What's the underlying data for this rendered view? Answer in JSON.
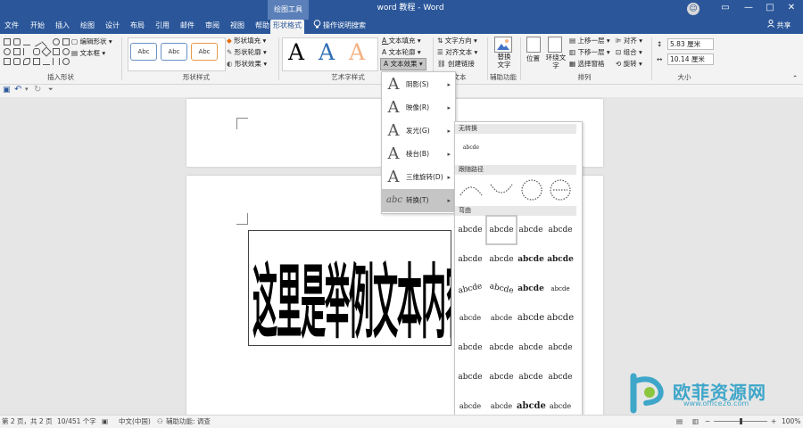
{
  "title_bar": {
    "context_tab": "绘图工具",
    "app_title": "word 教程 - Word",
    "avatar": "☺",
    "restore": "▭",
    "minimize": "—",
    "maximize": "□",
    "close": "✕"
  },
  "tabs": [
    "文件",
    "开始",
    "插入",
    "绘图",
    "设计",
    "布局",
    "引用",
    "邮件",
    "审阅",
    "视图",
    "帮助",
    "形状格式"
  ],
  "tell_me": "操作说明搜索",
  "share": "共享",
  "ribbon": {
    "insert_shape": {
      "edit_shape": "编辑形状",
      "text_box": "文本框",
      "label": "插入形状"
    },
    "shape_styles": {
      "sample": "Abc",
      "fill": "形状填充",
      "outline": "形状轮廓",
      "effects": "形状效果",
      "label": "形状样式"
    },
    "wordart": {
      "letter": "A",
      "text_fill": "文本填充",
      "text_outline": "文本轮廓",
      "text_effects": "文本效果",
      "label": "艺术字样式"
    },
    "text": {
      "direction": "文字方向",
      "align": "对齐文本",
      "link": "创建链接",
      "label": "文本"
    },
    "accessibility": {
      "alt_text": "替换文字",
      "label": "辅助功能"
    },
    "arrange": {
      "position": "位置",
      "wrap": "环绕文字",
      "forward": "上移一层",
      "backward": "下移一层",
      "pane": "选择窗格",
      "align": "对齐",
      "group": "组合",
      "rotate": "旋转",
      "label": "排列"
    },
    "size": {
      "height": "5.83 厘米",
      "width": "10.14 厘米",
      "label": "大小"
    }
  },
  "document": {
    "textbox_text": "这里是举例文本内容。"
  },
  "effects_menu": {
    "items": [
      {
        "label": "阴影(S)"
      },
      {
        "label": "映像(R)"
      },
      {
        "label": "发光(G)"
      },
      {
        "label": "棱台(B)"
      },
      {
        "label": "三维旋转(D)"
      },
      {
        "label": "转换(T)"
      }
    ]
  },
  "gallery": {
    "headers": [
      "无转换",
      "跟随路径",
      "弯曲"
    ],
    "sample": "abcde",
    "no_transform": "abcde"
  },
  "status": {
    "page": "第 2 页，共 2 页",
    "words": "10/451 个字",
    "language": "中文(中国)",
    "accessibility": "辅助功能: 调查",
    "zoom": "100%"
  },
  "watermark": {
    "name": "欧菲资源网",
    "url": "www.office26.com"
  },
  "colors": {
    "brand": "#2b579a",
    "ribbon": "#f3f3f3",
    "watermark": "#3ea6c9"
  }
}
